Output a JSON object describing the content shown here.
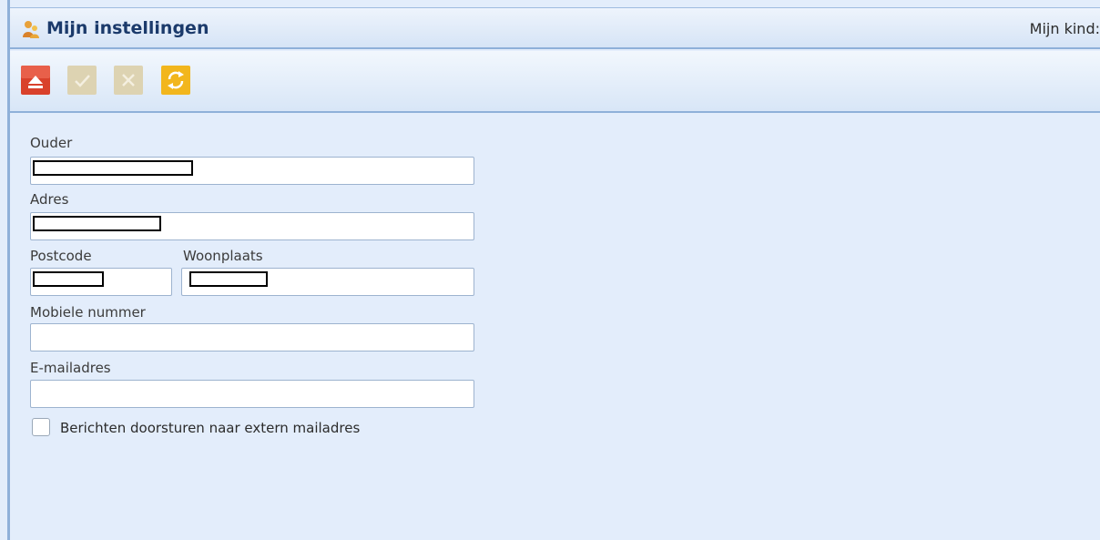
{
  "window": {
    "title": "Mijn instellingen",
    "child_label": "Mijn kind:"
  },
  "toolbar": {
    "buttons": [
      {
        "icon": "collapse-up-icon",
        "color": "#d9412b"
      },
      {
        "icon": "checkmark-icon",
        "color": "#d8cca4"
      },
      {
        "icon": "close-x-icon",
        "color": "#d8cca4"
      },
      {
        "icon": "refresh-icon",
        "color": "#f2b61d"
      }
    ]
  },
  "form": {
    "ouder": {
      "label": "Ouder",
      "value": ""
    },
    "adres": {
      "label": "Adres",
      "value": ""
    },
    "postcode": {
      "label": "Postcode",
      "value": ""
    },
    "woonplaats": {
      "label": "Woonplaats",
      "value": ""
    },
    "mobiel": {
      "label": "Mobiele nummer",
      "value": ""
    },
    "email": {
      "label": "E-mailadres",
      "value": ""
    },
    "forward": {
      "label": "Berichten doorsturen naar extern mailadres",
      "checked": false
    }
  }
}
